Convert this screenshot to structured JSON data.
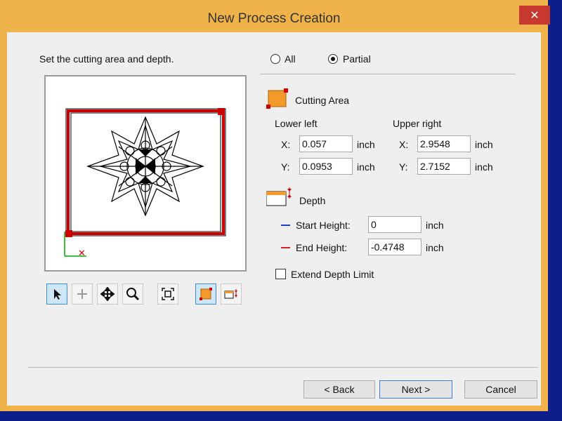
{
  "window": {
    "title": "New Process Creation",
    "close_icon": "close-icon"
  },
  "instruction": "Set the cutting area and depth.",
  "mode": {
    "options": [
      "All",
      "Partial"
    ],
    "selected": "Partial"
  },
  "cutting_area": {
    "heading": "Cutting Area",
    "lower_left": {
      "label": "Lower left",
      "x_label": "X:",
      "x": "0.057",
      "y_label": "Y:",
      "y": "0.0953"
    },
    "upper_right": {
      "label": "Upper right",
      "x_label": "X:",
      "x": "2.9548",
      "y_label": "Y:",
      "y": "2.7152"
    },
    "unit": "inch"
  },
  "depth": {
    "heading": "Depth",
    "start_height_label": "Start Height:",
    "start_height": "0",
    "end_height_label": "End Height:",
    "end_height": "-0.4748",
    "unit": "inch",
    "start_color": "#1f3fc8",
    "end_color": "#d42020"
  },
  "extend_depth_limit": {
    "label": "Extend Depth Limit",
    "checked": false
  },
  "toolbar": [
    "select-arrow-icon",
    "pan-icon",
    "move-icon",
    "zoom-icon",
    "fit-view-icon",
    "cutting-area-tool-icon",
    "depth-tool-icon"
  ],
  "buttons": {
    "back": "< Back",
    "next": "Next >",
    "cancel": "Cancel"
  },
  "colors": {
    "window_frame": "#f0b24a",
    "close": "#c7392f",
    "area_red": "#cc0000",
    "area_fill": "#f39a2a"
  }
}
